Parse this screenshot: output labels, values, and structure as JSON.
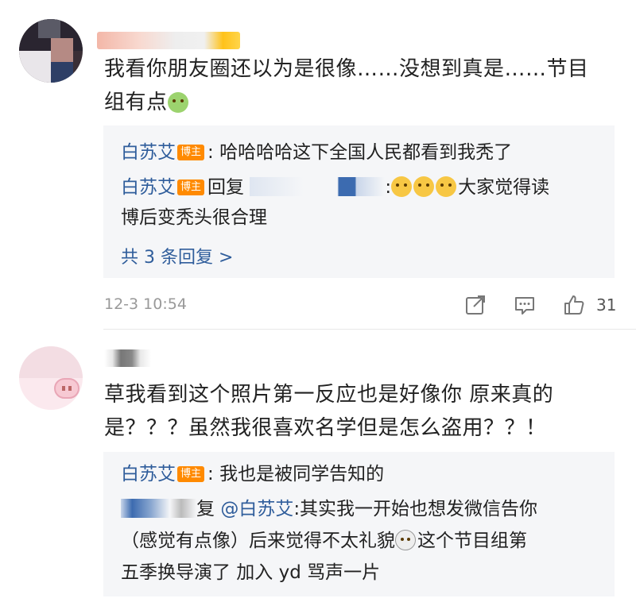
{
  "comments": [
    {
      "text_line1": "我看你朋友圈还以为是很像……没想到真是……节目",
      "text_line2": "组有点",
      "emoji": "nauseated-face",
      "replies": [
        {
          "author": "白苏艾",
          "badge": "博主",
          "separator": ":",
          "text": "哈哈哈哈这下全国人民都看到我秃了"
        },
        {
          "author": "白苏艾",
          "badge": "博主",
          "reply_word": "回复",
          "text_after_emojis": "大家觉得读",
          "text_line2": "博后变秃头很合理",
          "emoji": "crying-laughing-face"
        }
      ],
      "more_replies": "共 3 条回复 >",
      "time": "12-3 10:54",
      "likes": "31"
    },
    {
      "text_line1": "草我看到这个照片第一反应也是好像你 原来真的",
      "text_line2": "是？？？虽然我很喜欢名学但是怎么盗用？？！",
      "replies": [
        {
          "author": "白苏艾",
          "badge": "博主",
          "separator": ":",
          "text": "我也是被同学告知的"
        },
        {
          "reply_word": "复",
          "mention": "@白苏艾",
          "text": ":其实我一开始也想发微信告你",
          "text_line2": "（感觉有点像）后来觉得不太礼貌",
          "text_line2b": "这个节目组第",
          "text_line3": "五季换导演了 加入 yd 骂声一片",
          "emoji": "shocked-face"
        }
      ]
    }
  ],
  "colors": {
    "username_link": "#2f5d9b",
    "badge": "#ff8a00",
    "reply_bg": "#f5f6f8",
    "meta_text": "#999999"
  },
  "icons": [
    "share-icon",
    "comment-icon",
    "like-icon"
  ]
}
